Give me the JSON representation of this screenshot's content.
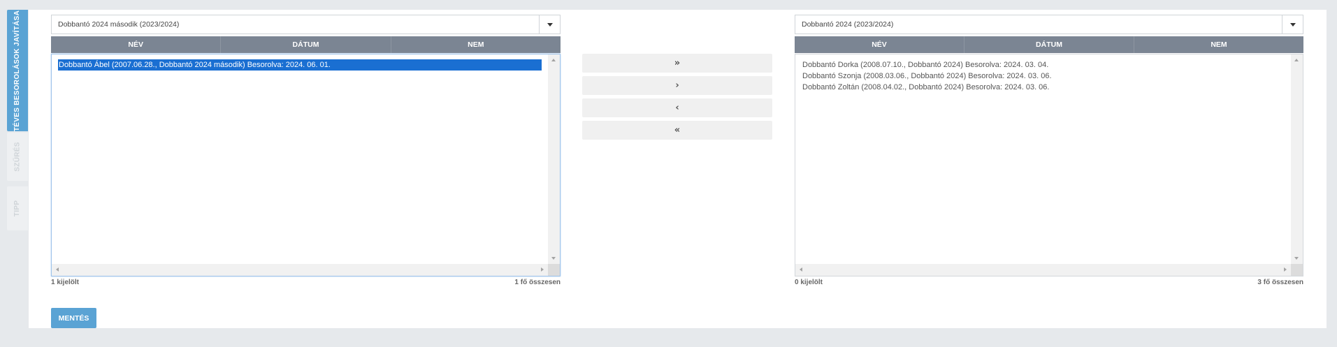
{
  "side_tabs": [
    {
      "label": "TÉVES BESOROLÁSOK JAVÍTÁSA",
      "active": true
    },
    {
      "label": "SZŰRÉS",
      "active": false
    },
    {
      "label": "TIPP",
      "active": false
    }
  ],
  "left": {
    "select_value": "Dobbantó 2024 második (2023/2024)",
    "columns": [
      "NÉV",
      "DÁTUM",
      "NEM"
    ],
    "items": [
      {
        "text": "Dobbantó Ábel (2007.06.28., Dobbantó 2024 második) Besorolva: 2024. 06. 01.",
        "selected": true
      }
    ],
    "selected_count": "1 kijelölt",
    "total_count": "1 fő összesen"
  },
  "right": {
    "select_value": "Dobbantó 2024 (2023/2024)",
    "columns": [
      "NÉV",
      "DÁTUM",
      "NEM"
    ],
    "items": [
      {
        "text": "Dobbantó Dorka (2008.07.10., Dobbantó 2024) Besorolva: 2024. 03. 04.",
        "selected": false
      },
      {
        "text": "Dobbantó Szonja (2008.03.06., Dobbantó 2024) Besorolva: 2024. 03. 06.",
        "selected": false
      },
      {
        "text": "Dobbantó Zoltán (2008.04.02., Dobbantó 2024) Besorolva: 2024. 03. 06.",
        "selected": false
      }
    ],
    "selected_count": "0 kijelölt",
    "total_count": "3 fő összesen"
  },
  "transfer_buttons": [
    {
      "icon": "double-chevron-right-icon",
      "glyph": "»"
    },
    {
      "icon": "chevron-right-icon",
      "glyph": "›"
    },
    {
      "icon": "chevron-left-icon",
      "glyph": "‹"
    },
    {
      "icon": "double-chevron-left-icon",
      "glyph": "«"
    }
  ],
  "save_label": "MENTÉS",
  "colors": {
    "accent": "#5aa3d4",
    "header": "#7b8593",
    "selection": "#1a6fd2"
  }
}
